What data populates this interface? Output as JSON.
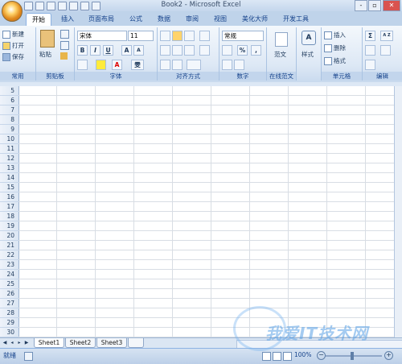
{
  "window": {
    "title": "Book2 - Microsoft Excel",
    "controls": [
      "-",
      "▫",
      "✕"
    ]
  },
  "tabs": [
    "开始",
    "插入",
    "页面布局",
    "公式",
    "数据",
    "审阅",
    "视图",
    "美化大师",
    "开发工具"
  ],
  "ribbon": {
    "common": {
      "new": "新建",
      "open": "打开",
      "save": "保存",
      "label": "常用"
    },
    "clipboard": {
      "paste": "粘贴",
      "label": "剪贴板"
    },
    "font": {
      "name": "宋体",
      "size": "11",
      "bold": "B",
      "italic": "I",
      "underline": "U",
      "grow": "A",
      "shrink": "A",
      "color": "A",
      "phonetic": "雯",
      "label": "字体"
    },
    "alignment": {
      "label": "对齐方式"
    },
    "number": {
      "format": "常规",
      "percent": "%",
      "comma": ",",
      "label": "数字"
    },
    "online_template": {
      "button": "范文",
      "label": "在线范文"
    },
    "styles": {
      "button": "样式"
    },
    "cells": {
      "insert": "插入",
      "delete": "删除",
      "format": "格式",
      "label": "单元格"
    },
    "editing": {
      "sum": "Σ",
      "sort": "A Z",
      "label": "编辑"
    }
  },
  "row_numbers": [
    "5",
    "6",
    "7",
    "8",
    "9",
    "10",
    "11",
    "12",
    "13",
    "14",
    "15",
    "16",
    "17",
    "18",
    "19",
    "20",
    "21",
    "22",
    "23",
    "24",
    "25",
    "26",
    "27",
    "28",
    "29",
    "30"
  ],
  "sheets": [
    "Sheet1",
    "Sheet2",
    "Sheet3"
  ],
  "active_sheet": "Sheet1",
  "status": {
    "text": "就绪",
    "zoom": "100%"
  },
  "watermark": "我爱IT技术网"
}
